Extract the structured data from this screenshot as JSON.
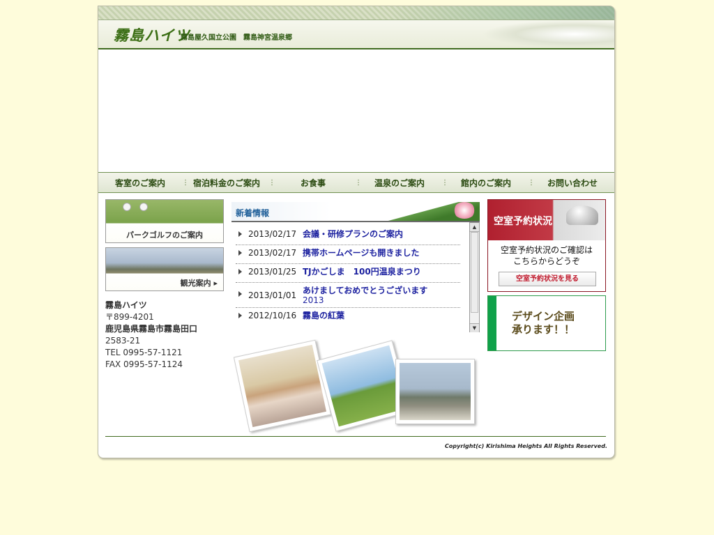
{
  "header": {
    "logo": "霧島ハイツ",
    "park_name": "霧島屋久国立公園",
    "onsen_name": "霧島神宮温泉郷"
  },
  "nav": {
    "items": [
      {
        "label": "客室のご案内"
      },
      {
        "label": "宿泊料金のご案内"
      },
      {
        "label": "お食事"
      },
      {
        "label": "温泉のご案内"
      },
      {
        "label": "館内のご案内"
      },
      {
        "label": "お問い合わせ"
      }
    ],
    "separator": "⋮"
  },
  "left": {
    "banners": [
      {
        "label": "パークゴルフのご案内"
      },
      {
        "label": "観光案内 ▸"
      }
    ],
    "address": {
      "name": "霧島ハイツ",
      "postal": "〒899-4201",
      "line1": "鹿児島県霧島市霧島田口",
      "line2": "2583-21",
      "tel": "TEL 0995-57-1121",
      "fax": "FAX 0995-57-1124"
    }
  },
  "news": {
    "title": "新着情報",
    "items": [
      {
        "date": "2013/02/17",
        "title": "会議・研修プランのご案内",
        "title2": ""
      },
      {
        "date": "2013/02/17",
        "title": "携帯ホームページも開きました",
        "title2": ""
      },
      {
        "date": "2013/01/25",
        "title": "TJかごしま　100円温泉まつり",
        "title2": ""
      },
      {
        "date": "2013/01/01",
        "title": "あけましておめでとうございます",
        "title2": "2013"
      },
      {
        "date": "2012/10/16",
        "title": "霧島の紅葉",
        "title2": ""
      }
    ]
  },
  "right": {
    "reserve": {
      "title": "空室予約状況",
      "text1": "空室予約状況のご確認は",
      "text2": "こちらからどうぞ",
      "button": "空室予約状況を見る"
    },
    "design": {
      "line1": "デザイン企画",
      "line2": "承ります！！"
    }
  },
  "footer": {
    "copyright": "Copyright(c) Kirishima Heights All Rights Reserved."
  },
  "colors": {
    "page_bg": "#fefcdb",
    "accent_green": "#3f6a1e",
    "link_blue": "#1d22a0",
    "reserve_red": "#b0202f"
  }
}
